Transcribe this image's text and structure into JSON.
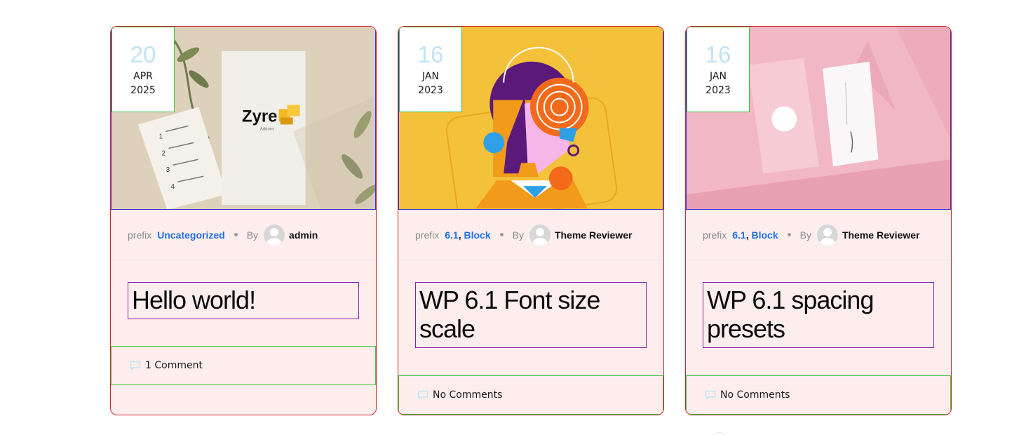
{
  "posts": [
    {
      "date": {
        "day": "20",
        "month": "APR",
        "year": "2025"
      },
      "meta": {
        "prefix": "prefix",
        "categories": [
          "Uncategorized"
        ],
        "by": "By",
        "author": "admin"
      },
      "title": "Hello world!",
      "comments": "1 Comment",
      "image": {
        "brand": "Zyre",
        "brand_sub": "Addons",
        "list_items": [
          "1",
          "2",
          "3",
          "4"
        ]
      }
    },
    {
      "date": {
        "day": "16",
        "month": "JAN",
        "year": "2023"
      },
      "meta": {
        "prefix": "prefix",
        "categories": [
          "6.1",
          "Block"
        ],
        "separator": ",",
        "by": "By",
        "author": "Theme Reviewer"
      },
      "title": "WP 6.1 Font size scale",
      "comments": "No Comments"
    },
    {
      "date": {
        "day": "16",
        "month": "JAN",
        "year": "2023"
      },
      "meta": {
        "prefix": "prefix",
        "categories": [
          "6.1",
          "Block"
        ],
        "separator": ",",
        "by": "By",
        "author": "Theme Reviewer"
      },
      "title": "WP 6.1 spacing presets",
      "comments": "No Comments"
    }
  ],
  "colors": {
    "card_bg": "#fdeeed",
    "card_border": "#d0262f",
    "category_link": "#1f6fe6",
    "date_day": "#bfe3f2",
    "title_outline": "#8a1fb5",
    "comments_outline": "#3ac43a"
  },
  "icons": {
    "comment": "comment-bubble-icon",
    "avatar": "default-avatar-icon"
  }
}
